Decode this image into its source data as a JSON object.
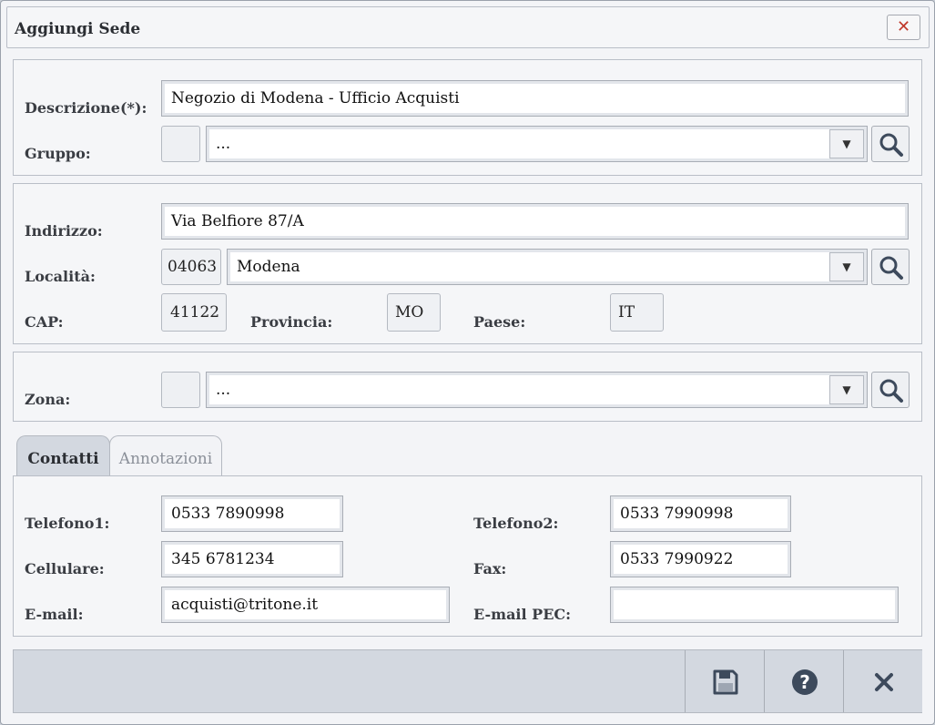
{
  "window": {
    "title": "Aggiungi Sede",
    "close_glyph": "✕"
  },
  "general": {
    "descrizione_label": "Descrizione(*):",
    "descrizione_value": "Negozio di Modena - Ufficio Acquisti",
    "gruppo_label": "Gruppo:",
    "gruppo_value": "..."
  },
  "address": {
    "indirizzo_label": "Indirizzo:",
    "indirizzo_value": "Via Belfiore 87/A",
    "localita_label": "Località:",
    "localita_code": "04063",
    "localita_value": "Modena",
    "cap_label": "CAP:",
    "cap_value": "41122",
    "provincia_label": "Provincia:",
    "provincia_value": "MO",
    "paese_label": "Paese:",
    "paese_value": "IT"
  },
  "zone": {
    "zona_label": "Zona:",
    "zona_value": "..."
  },
  "tabs": [
    {
      "label": "Contatti",
      "active": true
    },
    {
      "label": "Annotazioni",
      "active": false
    }
  ],
  "contacts": {
    "telefono1_label": "Telefono1:",
    "telefono1_value": "0533 7890998",
    "telefono2_label": "Telefono2:",
    "telefono2_value": "0533 7990998",
    "cellulare_label": "Cellulare:",
    "cellulare_value": "345 6781234",
    "fax_label": "Fax:",
    "fax_value": "0533 7990922",
    "email_label": "E-mail:",
    "email_value": "acquisti@tritone.it",
    "pec_label": "E-mail PEC:",
    "pec_value": ""
  },
  "footer": {
    "buttons": [
      "save-icon",
      "help-icon",
      "close-icon"
    ]
  },
  "colors": {
    "accent_close": "#c0392b",
    "icon_dark": "#3d4a5c",
    "panel": "#d3d8e0"
  }
}
